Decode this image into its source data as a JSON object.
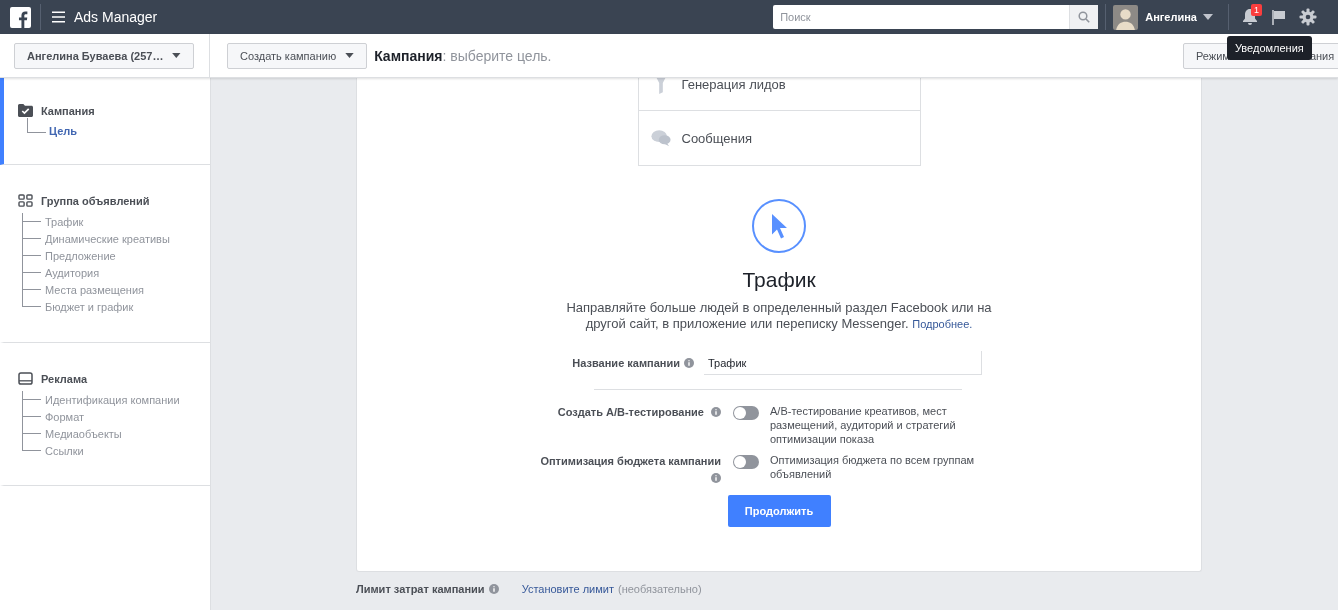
{
  "topbar": {
    "app_title": "Ads Manager",
    "search": {
      "placeholder": "Поиск"
    },
    "user": {
      "name": "Ангелина"
    },
    "notifications": {
      "badge": "1"
    },
    "tooltip": "Уведомления"
  },
  "toolbar": {
    "account": "Ангелина Буваева (257…",
    "create_button": "Создать кампанию",
    "heading": "**Кампания**: выберите цель.",
    "mode_button": [
      "Режим",
      "ания"
    ]
  },
  "sidebar": {
    "sections": [
      {
        "title": "Кампания",
        "kind": "campaign",
        "selected": true,
        "children": [
          {
            "label": "Цель",
            "selected": true
          }
        ]
      },
      {
        "title": "Группа объявлений",
        "kind": "adset",
        "selected": false,
        "children": [
          {
            "label": "Трафик",
            "selected": false
          },
          {
            "label": "Динамические креативы",
            "selected": false
          },
          {
            "label": "Предложение",
            "selected": false
          },
          {
            "label": "Аудитория",
            "selected": false
          },
          {
            "label": "Места размещения",
            "selected": false
          },
          {
            "label": "Бюджет и график",
            "selected": false
          }
        ]
      },
      {
        "title": "Реклама",
        "kind": "ad",
        "selected": false,
        "children": [
          {
            "label": "Идентификация компании",
            "selected": false
          },
          {
            "label": "Формат",
            "selected": false
          },
          {
            "label": "Медиаобъекты",
            "selected": false
          },
          {
            "label": "Ссылки",
            "selected": false
          }
        ]
      }
    ]
  },
  "objectives": [
    {
      "label": "Генерация лидов",
      "kind": "lead"
    },
    {
      "label": "Сообщения",
      "kind": "messages"
    }
  ],
  "selected_objective": {
    "title": "Трафик",
    "description": "Направляйте больше людей в определенный раздел Facebook или на другой сайт, в приложение или переписку Messenger.",
    "link": "Подробнее."
  },
  "form": {
    "name_label": "Название кампании",
    "name_value": "Трафик",
    "toggles": [
      {
        "label": "Создать A/B-тестирование",
        "on": false,
        "description": "A/B-тестирование креативов, мест размещений, аудиторий и стратегий оптимизации показа"
      },
      {
        "label": "Оптимизация бюджета кампании",
        "on": false,
        "description": "Оптимизация бюджета по всем группам объявлений"
      }
    ],
    "submit": "Продолжить"
  },
  "spending_limit": {
    "label": "Лимит затрат кампании",
    "link": "Установите лимит",
    "hint": "(необязательно)"
  }
}
